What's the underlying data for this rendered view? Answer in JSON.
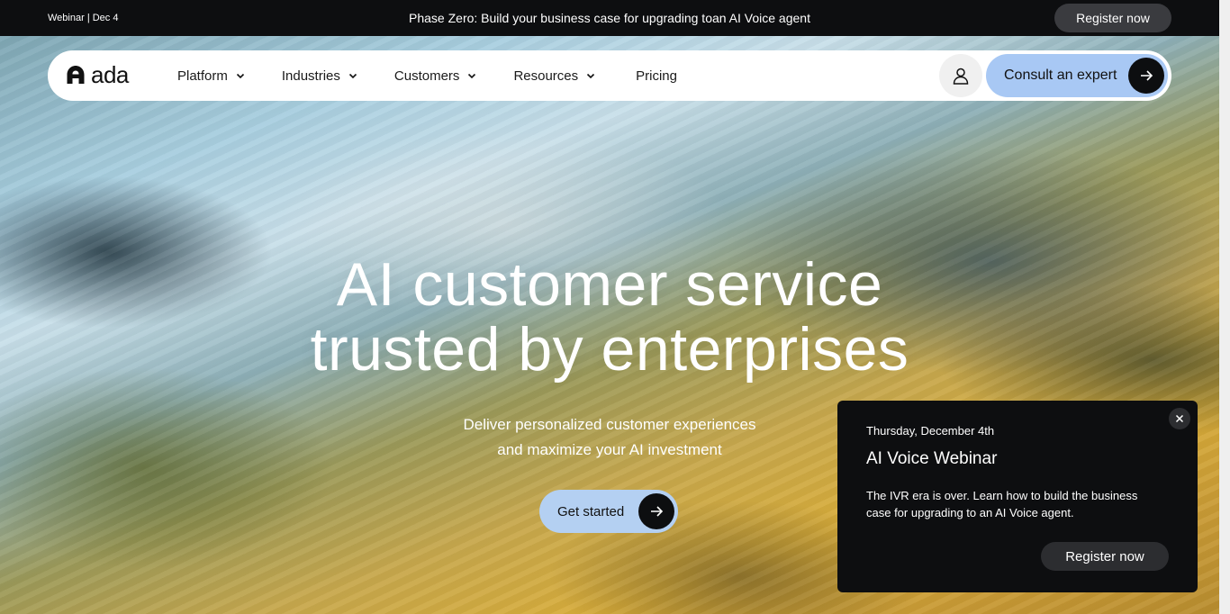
{
  "topbar": {
    "tag": "Webinar | Dec 4",
    "message": "Phase Zero: Build your business case for upgrading toan AI Voice agent",
    "register_label": "Register now"
  },
  "nav": {
    "logo_text": "ada",
    "items": [
      {
        "label": "Platform"
      },
      {
        "label": "Industries"
      },
      {
        "label": "Customers"
      },
      {
        "label": "Resources"
      }
    ],
    "pricing_label": "Pricing",
    "consult_label": "Consult an expert"
  },
  "hero": {
    "title_line1": "AI customer service",
    "title_line2": "trusted by enterprises",
    "subtitle_line1": "Deliver personalized customer experiences",
    "subtitle_line2": "and maximize your AI investment",
    "cta_label": "Get started"
  },
  "popup": {
    "date": "Thursday, December 4th",
    "title": "AI Voice Webinar",
    "body": "The IVR era is over. Learn how to build the business case for upgrading to an AI Voice agent.",
    "register_label": "Register now"
  },
  "icons": {
    "logo": "ada-logo-icon",
    "chevron": "chevron-down-icon",
    "user": "user-icon",
    "arrow": "arrow-right-icon",
    "close": "close-icon"
  },
  "colors": {
    "dark": "#0d0e10",
    "consult_bg": "#a8c8f4",
    "cta_bg": "#b4d0f2"
  }
}
